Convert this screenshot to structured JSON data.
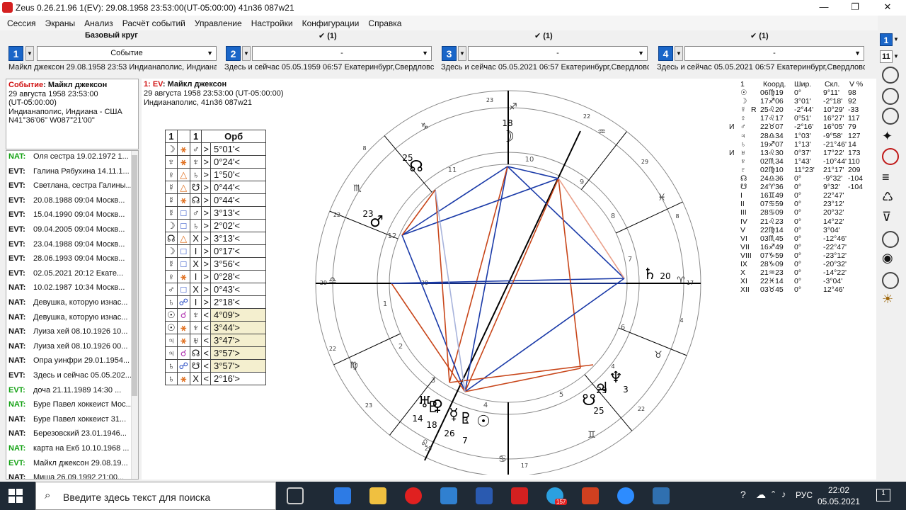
{
  "window": {
    "title": "Zeus  0.26.21.96    1(EV): 29.08.1958 23:53:00(UT-05:00:00) 41n36 087w21",
    "min": "—",
    "max": "❐",
    "close": "✕"
  },
  "menu": [
    "Сессия",
    "Экраны",
    "Анализ",
    "Расчёт событий",
    "Управление",
    "Настройки",
    "Конфигурации",
    "Справка"
  ],
  "slots": [
    {
      "num": "1",
      "head": "Базовый круг",
      "select": "Событие",
      "desc": "Майкл джексон 29.08.1958 23:53 Индианаполис, Индиана - США"
    },
    {
      "num": "2",
      "head": "✔ (1)",
      "select": "-",
      "desc": "Здесь и сейчас 05.05.1959 06:57 Екатеринбург,Свердловская"
    },
    {
      "num": "3",
      "head": "✔ (1)",
      "select": "-",
      "desc": "Здесь и сейчас 05.05.2021 06:57 Екатеринбург,Свердловская"
    },
    {
      "num": "4",
      "head": "✔ (1)",
      "select": "-",
      "desc": "Здесь и сейчас 05.05.2021 06:57 Екатеринбург,Свердловская"
    }
  ],
  "event": {
    "label": "Событие",
    "name": ": Майкл джексон",
    "date": "29 августа 1958 23:53:00",
    "tz": "(UT-05:00:00)",
    "place": "Индианаполис, Индиана - США",
    "coords": "N41°36'06\" W087°21'00\""
  },
  "list": [
    {
      "tag": "NAT:",
      "text": "Оля сестра 19.02.1972 1...",
      "green": true
    },
    {
      "tag": "EVT:",
      "text": "Галина Рябухина 14.11.1...",
      "green": false
    },
    {
      "tag": "EVT:",
      "text": "Светлана, сестра Галины...",
      "green": false
    },
    {
      "tag": "EVT:",
      "text": "20.08.1988 09:04 Москв...",
      "green": false
    },
    {
      "tag": "EVT:",
      "text": "15.04.1990 09:04 Москв...",
      "green": false
    },
    {
      "tag": "EVT:",
      "text": "09.04.2005 09:04 Москв...",
      "green": false
    },
    {
      "tag": "EVT:",
      "text": "23.04.1988 09:04 Москв...",
      "green": false
    },
    {
      "tag": "EVT:",
      "text": "28.06.1993 09:04 Москв...",
      "green": false
    },
    {
      "tag": "EVT:",
      "text": "02.05.2021 20:12 Екате...",
      "green": false
    },
    {
      "tag": "NAT:",
      "text": "10.02.1987 10:34 Москв...",
      "green": false
    },
    {
      "tag": "NAT:",
      "text": "Девушка, которую изнас...",
      "green": false
    },
    {
      "tag": "NAT:",
      "text": "Девушка, которую изнас...",
      "green": false
    },
    {
      "tag": "NAT:",
      "text": "Луиза хей 08.10.1926 10...",
      "green": false
    },
    {
      "tag": "NAT:",
      "text": "Луиза хей 08.10.1926 00...",
      "green": false
    },
    {
      "tag": "NAT:",
      "text": "Опра уинфри 29.01.1954...",
      "green": false
    },
    {
      "tag": "EVT:",
      "text": "Здесь и сейчас 05.05.202...",
      "green": false
    },
    {
      "tag": "EVT:",
      "text": "доча 21.11.1989 14:30 ...",
      "green": true
    },
    {
      "tag": "NAT:",
      "text": "Буре Павел хоккеист Мос...",
      "green": true
    },
    {
      "tag": "NAT:",
      "text": "Буре Павел хоккеист  31...",
      "green": false
    },
    {
      "tag": "NAT:",
      "text": "Березовский  23.01.1946...",
      "green": false
    },
    {
      "tag": "NAT:",
      "text": "карта на Екб 10.10.1968 ...",
      "green": true
    },
    {
      "tag": "EVT:",
      "text": "Майкл джексон 29.08.19...",
      "green": true
    },
    {
      "tag": "NAT:",
      "text": "Миша 26.09.1992 21:00...",
      "green": false
    }
  ],
  "chartinfo": {
    "label": "1: EV",
    "name": ": Майкл джексон",
    "date": "29 августа 1958 23:53:00 (UT-05:00:00)",
    "place": "Индианаполис, 41n36 087w21"
  },
  "aspects": {
    "header": [
      "1",
      "",
      "1",
      "Орб"
    ],
    "rows": [
      {
        "p1": "☽",
        "asp": "⚹",
        "p2": "♂",
        "dir": ">",
        "orb": "5°01'<",
        "ac": "#e07020",
        "shade": false
      },
      {
        "p1": "♆",
        "asp": "⚹",
        "p2": "♆",
        "dir": ">",
        "orb": "0°24'<",
        "ac": "#e07020",
        "shade": false
      },
      {
        "p1": "♀",
        "asp": "△",
        "p2": "♄",
        "dir": ">",
        "orb": "1°50'<",
        "ac": "#e07020",
        "shade": false
      },
      {
        "p1": "☿",
        "asp": "△",
        "p2": "☋",
        "dir": ">",
        "orb": "0°44'<",
        "ac": "#e07020",
        "shade": false
      },
      {
        "p1": "☿",
        "asp": "⚹",
        "p2": "☊",
        "dir": ">",
        "orb": "0°44'<",
        "ac": "#e07020",
        "shade": false
      },
      {
        "p1": "☿",
        "asp": "□",
        "p2": "♂",
        "dir": ">",
        "orb": "3°13'<",
        "ac": "#1a40c0",
        "shade": false
      },
      {
        "p1": "☽",
        "asp": "□",
        "p2": "♄",
        "dir": ">",
        "orb": "2°02'<",
        "ac": "#1a40c0",
        "shade": false
      },
      {
        "p1": "☊",
        "asp": "△",
        "p2": "X",
        "dir": ">",
        "orb": "3°13'<",
        "ac": "#e07020",
        "shade": false
      },
      {
        "p1": "☽",
        "asp": "□",
        "p2": "I",
        "dir": ">",
        "orb": "0°17'<",
        "ac": "#1a40c0",
        "shade": false
      },
      {
        "p1": "☿",
        "asp": "□",
        "p2": "X",
        "dir": ">",
        "orb": "3°56'<",
        "ac": "#1a40c0",
        "shade": false
      },
      {
        "p1": "♀",
        "asp": "⚹",
        "p2": "I",
        "dir": ">",
        "orb": "0°28'<",
        "ac": "#e07020",
        "shade": false
      },
      {
        "p1": "♂",
        "asp": "□",
        "p2": "X",
        "dir": ">",
        "orb": "0°43'<",
        "ac": "#1a40c0",
        "shade": false
      },
      {
        "p1": "♄",
        "asp": "☍",
        "p2": "I",
        "dir": ">",
        "orb": "2°18'<",
        "ac": "#1a40c0",
        "shade": false
      },
      {
        "p1": "☉",
        "asp": "☌",
        "p2": "♆",
        "dir": "<",
        "orb": "4°09'>",
        "ac": "#b030b0",
        "shade": true
      },
      {
        "p1": "☉",
        "asp": "⚹",
        "p2": "♆",
        "dir": "<",
        "orb": "3°44'>",
        "ac": "#e07020",
        "shade": true
      },
      {
        "p1": "♃",
        "asp": "⚹",
        "p2": "♅",
        "dir": "<",
        "orb": "3°47'>",
        "ac": "#e07020",
        "shade": true
      },
      {
        "p1": "♃",
        "asp": "☌",
        "p2": "☊",
        "dir": "<",
        "orb": "3°57'>",
        "ac": "#b030b0",
        "shade": true
      },
      {
        "p1": "♄",
        "asp": "☍",
        "p2": "☋",
        "dir": "<",
        "orb": "3°57'>",
        "ac": "#1a40c0",
        "shade": true
      },
      {
        "p1": "♄",
        "asp": "⚹",
        "p2": "X",
        "dir": "<",
        "orb": "2°16'>",
        "ac": "#e07020",
        "shade": false
      }
    ]
  },
  "planets": {
    "header": {
      "n": "1",
      "k": "Коорд.",
      "s": "Шир.",
      "d": "Скл.",
      "v": "V %"
    },
    "rows": [
      {
        "m": "",
        "g": "☉",
        "r": "",
        "k": "06♍19",
        "s": "0°",
        "d": "9°11'",
        "v": "98"
      },
      {
        "m": "",
        "g": "☽",
        "r": "",
        "k": "17♐06",
        "s": "3°01'",
        "d": "-2°18'",
        "v": "92"
      },
      {
        "m": "",
        "g": "☿",
        "r": "R",
        "k": "25♌20",
        "s": "-2°44'",
        "d": "10°29'",
        "v": "-33"
      },
      {
        "m": "",
        "g": "♀",
        "r": "",
        "k": "17♌17",
        "s": "0°51'",
        "d": "16°27'",
        "v": "117"
      },
      {
        "m": "И",
        "g": "♂",
        "r": "",
        "k": "22♉07",
        "s": "-2°16'",
        "d": "16°05'",
        "v": "79"
      },
      {
        "m": "",
        "g": "♃",
        "r": "",
        "k": "28♎34",
        "s": "1°03'",
        "d": "-9°58'",
        "v": "127"
      },
      {
        "m": "",
        "g": "♄",
        "r": "",
        "k": "19♐07",
        "s": "1°13'",
        "d": "-21°46'",
        "v": "14"
      },
      {
        "m": "И",
        "g": "♅",
        "r": "",
        "k": "13♌30",
        "s": "0°37'",
        "d": "17°22'",
        "v": "173"
      },
      {
        "m": "",
        "g": "♆",
        "r": "",
        "k": "02♏34",
        "s": "1°43'",
        "d": "-10°44'",
        "v": "110"
      },
      {
        "m": "",
        "g": "♇",
        "r": "",
        "k": "02♍10",
        "s": "11°23'",
        "d": "21°17'",
        "v": "209"
      },
      {
        "m": "",
        "g": "☊",
        "r": "",
        "k": "24♎36",
        "s": "0°",
        "d": "-9°32'",
        "v": "-104"
      },
      {
        "m": "",
        "g": "☋",
        "r": "",
        "k": "24♈36",
        "s": "0°",
        "d": "9°32'",
        "v": "-104"
      },
      {
        "m": "",
        "g": "I",
        "r": "",
        "k": "16♊49",
        "s": "0°",
        "d": "22°47'",
        "v": ""
      },
      {
        "m": "",
        "g": "II",
        "r": "",
        "k": "07♋59",
        "s": "0°",
        "d": "23°12'",
        "v": ""
      },
      {
        "m": "",
        "g": "III",
        "r": "",
        "k": "28♋09",
        "s": "0°",
        "d": "20°32'",
        "v": ""
      },
      {
        "m": "",
        "g": "IV",
        "r": "",
        "k": "21♌23",
        "s": "0°",
        "d": "14°22'",
        "v": ""
      },
      {
        "m": "",
        "g": "V",
        "r": "",
        "k": "22♍14",
        "s": "0°",
        "d": "3°04'",
        "v": ""
      },
      {
        "m": "",
        "g": "VI",
        "r": "",
        "k": "03♏45",
        "s": "0°",
        "d": "-12°46'",
        "v": ""
      },
      {
        "m": "",
        "g": "VII",
        "r": "",
        "k": "16♐49",
        "s": "0°",
        "d": "-22°47'",
        "v": ""
      },
      {
        "m": "",
        "g": "VIII",
        "r": "",
        "k": "07♑59",
        "s": "0°",
        "d": "-23°12'",
        "v": ""
      },
      {
        "m": "",
        "g": "IX",
        "r": "",
        "k": "28♑09",
        "s": "0°",
        "d": "-20°32'",
        "v": ""
      },
      {
        "m": "",
        "g": "X",
        "r": "",
        "k": "21♒23",
        "s": "0°",
        "d": "-14°22'",
        "v": ""
      },
      {
        "m": "",
        "g": "XI",
        "r": "",
        "k": "22♓14",
        "s": "0°",
        "d": "-3°04'",
        "v": ""
      },
      {
        "m": "",
        "g": "XII",
        "r": "",
        "k": "03♉45",
        "s": "0°",
        "d": "12°46'",
        "v": ""
      }
    ]
  },
  "wheel": {
    "degree_labels": [
      "23",
      "22",
      "29",
      "8",
      "17",
      "4",
      "22",
      "29",
      "23",
      "22",
      "29",
      "8",
      "17",
      "4",
      "22",
      "29"
    ],
    "house_numbers": [
      "1",
      "2",
      "3",
      "4",
      "5",
      "6",
      "7",
      "8",
      "9",
      "10",
      "11",
      "12"
    ],
    "planet_labels": [
      {
        "glyph": "☽",
        "deg": "18"
      },
      {
        "glyph": "☊",
        "deg": "25"
      },
      {
        "glyph": "♂",
        "deg": "23"
      },
      {
        "glyph": "♇",
        "deg": ""
      },
      {
        "glyph": "♆",
        "deg": "3"
      },
      {
        "glyph": "♃",
        "deg": "29"
      },
      {
        "glyph": "☋",
        "deg": "25"
      },
      {
        "glyph": "♄",
        "deg": "20"
      },
      {
        "glyph": "♅",
        "deg": "14"
      },
      {
        "glyph": "♀",
        "deg": "18"
      },
      {
        "glyph": "☿",
        "deg": "26"
      },
      {
        "glyph": "☉",
        "deg": "7"
      },
      {
        "glyph": "♇",
        "deg": "3"
      }
    ],
    "zodiac": [
      "♐",
      "♒",
      "♓",
      "♈",
      "♉",
      "♊",
      "♋",
      "♌",
      "♍",
      "♎",
      "♏",
      "♑"
    ]
  },
  "right_toolbar": {
    "slot": "1",
    "count": "11"
  },
  "taskbar": {
    "search_placeholder": "Введите здесь текст для поиска",
    "lang": "РУС",
    "time": "22:02",
    "date": "05.05.2021",
    "telegram_badge": "157",
    "notif": "1"
  }
}
